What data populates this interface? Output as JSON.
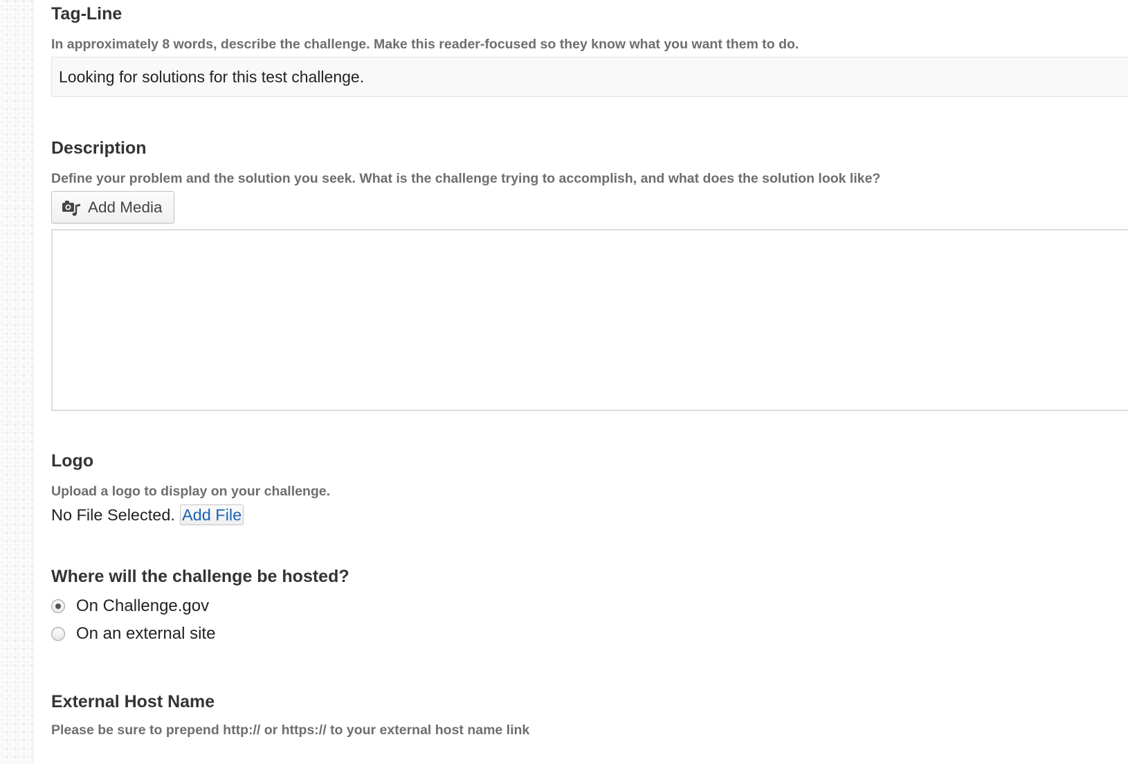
{
  "tagline": {
    "heading": "Tag-Line",
    "help": "In approximately 8 words, describe the challenge. Make this reader-focused so they know what you want them to do.",
    "value": "Looking for solutions for this test challenge."
  },
  "description": {
    "heading": "Description",
    "help": "Define your problem and the solution you seek. What is the challenge trying to accomplish, and what does the solution look like?",
    "add_media_label": "Add Media",
    "add_media_icon": "media-icon",
    "value": ""
  },
  "logo": {
    "heading": "Logo",
    "help": "Upload a logo to display on your challenge.",
    "file_status": "No File Selected.",
    "add_file_label": "Add File"
  },
  "hosting": {
    "heading": "Where will the challenge be hosted?",
    "options": [
      {
        "label": "On Challenge.gov",
        "checked": true
      },
      {
        "label": "On an external site",
        "checked": false
      }
    ]
  },
  "external_host": {
    "heading": "External Host Name",
    "help": "Please be sure to prepend http:// or https:// to your external host name link"
  }
}
